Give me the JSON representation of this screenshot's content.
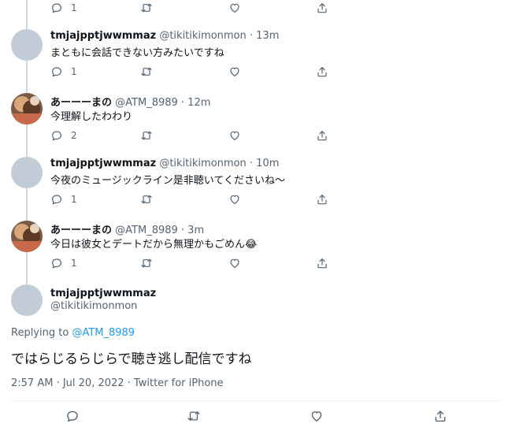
{
  "tweets": [
    {
      "name": "",
      "handle": "",
      "time": "",
      "text": "",
      "replies": "1"
    },
    {
      "name": "tmjajpptjwwmmaz",
      "handle": "@tikitikimonmon",
      "time": "· 13m",
      "text": "まともに会話できない方みたいですね",
      "replies": "1"
    },
    {
      "name": "あーーーまの",
      "handle": "@ATM_8989",
      "time": "· 12m",
      "text": "今理解したわわり",
      "replies": "2"
    },
    {
      "name": "tmjajpptjwwmmaz",
      "handle": "@tikitikimonmon",
      "time": "· 10m",
      "text": "今夜のミュージックライン是非聴いてくださいね〜",
      "replies": "1"
    },
    {
      "name": "あーーーまの",
      "handle": "@ATM_8989",
      "time": "· 3m",
      "text": "今日は彼女とデートだから無理かもごめん😂",
      "replies": "1"
    }
  ],
  "main_tweet": {
    "name": "tmjajpptjwwmmaz",
    "handle": "@tikitikimonmon",
    "replying_prefix": "Replying to ",
    "replying_to": "@ATM_8989",
    "text": "ではらじるらじらで聴き逃し配信ですね",
    "timestamp": "2:57 AM · Jul 20, 2022 · Twitter for iPhone"
  },
  "icons": {
    "reply": "reply-icon",
    "retweet": "retweet-icon",
    "like": "like-icon",
    "share": "share-icon"
  },
  "colors": {
    "link": "#1d9bf0",
    "muted": "#536471",
    "thread_line": "#cfd9de",
    "avatar_placeholder": "#c1ccd6"
  }
}
